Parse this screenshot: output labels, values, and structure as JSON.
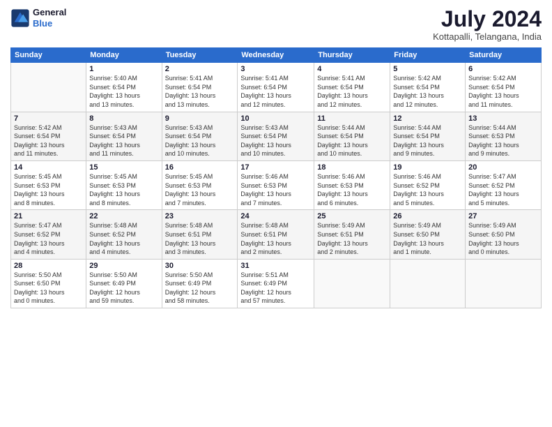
{
  "logo": {
    "line1": "General",
    "line2": "Blue"
  },
  "title": "July 2024",
  "subtitle": "Kottapalli, Telangana, India",
  "days_of_week": [
    "Sunday",
    "Monday",
    "Tuesday",
    "Wednesday",
    "Thursday",
    "Friday",
    "Saturday"
  ],
  "weeks": [
    [
      {
        "day": "",
        "info": ""
      },
      {
        "day": "1",
        "info": "Sunrise: 5:40 AM\nSunset: 6:54 PM\nDaylight: 13 hours\nand 13 minutes."
      },
      {
        "day": "2",
        "info": "Sunrise: 5:41 AM\nSunset: 6:54 PM\nDaylight: 13 hours\nand 13 minutes."
      },
      {
        "day": "3",
        "info": "Sunrise: 5:41 AM\nSunset: 6:54 PM\nDaylight: 13 hours\nand 12 minutes."
      },
      {
        "day": "4",
        "info": "Sunrise: 5:41 AM\nSunset: 6:54 PM\nDaylight: 13 hours\nand 12 minutes."
      },
      {
        "day": "5",
        "info": "Sunrise: 5:42 AM\nSunset: 6:54 PM\nDaylight: 13 hours\nand 12 minutes."
      },
      {
        "day": "6",
        "info": "Sunrise: 5:42 AM\nSunset: 6:54 PM\nDaylight: 13 hours\nand 11 minutes."
      }
    ],
    [
      {
        "day": "7",
        "info": "Sunrise: 5:42 AM\nSunset: 6:54 PM\nDaylight: 13 hours\nand 11 minutes."
      },
      {
        "day": "8",
        "info": "Sunrise: 5:43 AM\nSunset: 6:54 PM\nDaylight: 13 hours\nand 11 minutes."
      },
      {
        "day": "9",
        "info": "Sunrise: 5:43 AM\nSunset: 6:54 PM\nDaylight: 13 hours\nand 10 minutes."
      },
      {
        "day": "10",
        "info": "Sunrise: 5:43 AM\nSunset: 6:54 PM\nDaylight: 13 hours\nand 10 minutes."
      },
      {
        "day": "11",
        "info": "Sunrise: 5:44 AM\nSunset: 6:54 PM\nDaylight: 13 hours\nand 10 minutes."
      },
      {
        "day": "12",
        "info": "Sunrise: 5:44 AM\nSunset: 6:54 PM\nDaylight: 13 hours\nand 9 minutes."
      },
      {
        "day": "13",
        "info": "Sunrise: 5:44 AM\nSunset: 6:53 PM\nDaylight: 13 hours\nand 9 minutes."
      }
    ],
    [
      {
        "day": "14",
        "info": "Sunrise: 5:45 AM\nSunset: 6:53 PM\nDaylight: 13 hours\nand 8 minutes."
      },
      {
        "day": "15",
        "info": "Sunrise: 5:45 AM\nSunset: 6:53 PM\nDaylight: 13 hours\nand 8 minutes."
      },
      {
        "day": "16",
        "info": "Sunrise: 5:45 AM\nSunset: 6:53 PM\nDaylight: 13 hours\nand 7 minutes."
      },
      {
        "day": "17",
        "info": "Sunrise: 5:46 AM\nSunset: 6:53 PM\nDaylight: 13 hours\nand 7 minutes."
      },
      {
        "day": "18",
        "info": "Sunrise: 5:46 AM\nSunset: 6:53 PM\nDaylight: 13 hours\nand 6 minutes."
      },
      {
        "day": "19",
        "info": "Sunrise: 5:46 AM\nSunset: 6:52 PM\nDaylight: 13 hours\nand 5 minutes."
      },
      {
        "day": "20",
        "info": "Sunrise: 5:47 AM\nSunset: 6:52 PM\nDaylight: 13 hours\nand 5 minutes."
      }
    ],
    [
      {
        "day": "21",
        "info": "Sunrise: 5:47 AM\nSunset: 6:52 PM\nDaylight: 13 hours\nand 4 minutes."
      },
      {
        "day": "22",
        "info": "Sunrise: 5:48 AM\nSunset: 6:52 PM\nDaylight: 13 hours\nand 4 minutes."
      },
      {
        "day": "23",
        "info": "Sunrise: 5:48 AM\nSunset: 6:51 PM\nDaylight: 13 hours\nand 3 minutes."
      },
      {
        "day": "24",
        "info": "Sunrise: 5:48 AM\nSunset: 6:51 PM\nDaylight: 13 hours\nand 2 minutes."
      },
      {
        "day": "25",
        "info": "Sunrise: 5:49 AM\nSunset: 6:51 PM\nDaylight: 13 hours\nand 2 minutes."
      },
      {
        "day": "26",
        "info": "Sunrise: 5:49 AM\nSunset: 6:50 PM\nDaylight: 13 hours\nand 1 minute."
      },
      {
        "day": "27",
        "info": "Sunrise: 5:49 AM\nSunset: 6:50 PM\nDaylight: 13 hours\nand 0 minutes."
      }
    ],
    [
      {
        "day": "28",
        "info": "Sunrise: 5:50 AM\nSunset: 6:50 PM\nDaylight: 13 hours\nand 0 minutes."
      },
      {
        "day": "29",
        "info": "Sunrise: 5:50 AM\nSunset: 6:49 PM\nDaylight: 12 hours\nand 59 minutes."
      },
      {
        "day": "30",
        "info": "Sunrise: 5:50 AM\nSunset: 6:49 PM\nDaylight: 12 hours\nand 58 minutes."
      },
      {
        "day": "31",
        "info": "Sunrise: 5:51 AM\nSunset: 6:49 PM\nDaylight: 12 hours\nand 57 minutes."
      },
      {
        "day": "",
        "info": ""
      },
      {
        "day": "",
        "info": ""
      },
      {
        "day": "",
        "info": ""
      }
    ]
  ]
}
